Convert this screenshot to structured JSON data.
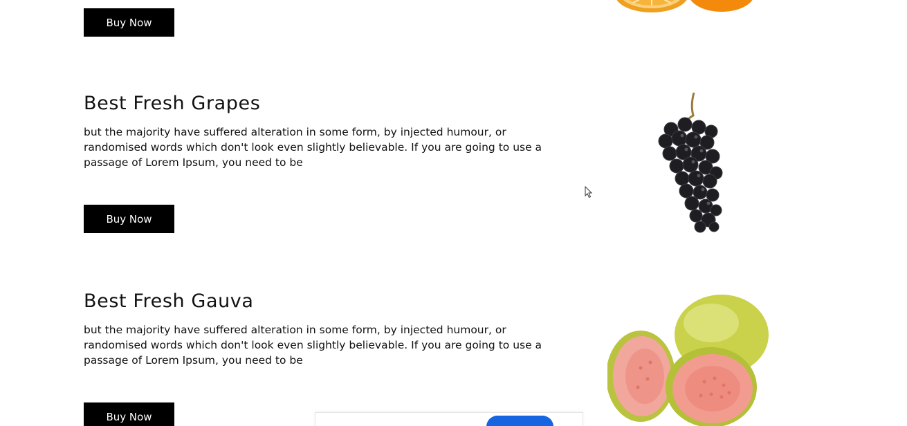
{
  "products": [
    {
      "title": "",
      "description": "",
      "button_label": "Buy Now",
      "image_icon": "orange-fruit-image"
    },
    {
      "title": "Best Fresh Grapes",
      "description": "but the majority have suffered alteration in some form, by injected humour, or randomised words which don't look even slightly believable. If you are going to use a passage of Lorem Ipsum, you need to be",
      "button_label": "Buy Now",
      "image_icon": "grapes-fruit-image"
    },
    {
      "title": "Best Fresh Gauva",
      "description": "but the majority have suffered alteration in some form, by injected humour, or randomised words which don't look even slightly believable. If you are going to use a passage of Lorem Ipsum, you need to be",
      "button_label": "Buy Now",
      "image_icon": "guava-fruit-image"
    }
  ],
  "colors": {
    "button_bg": "#000000",
    "button_text": "#ffffff",
    "text": "#111111",
    "pill": "#1565e0"
  }
}
